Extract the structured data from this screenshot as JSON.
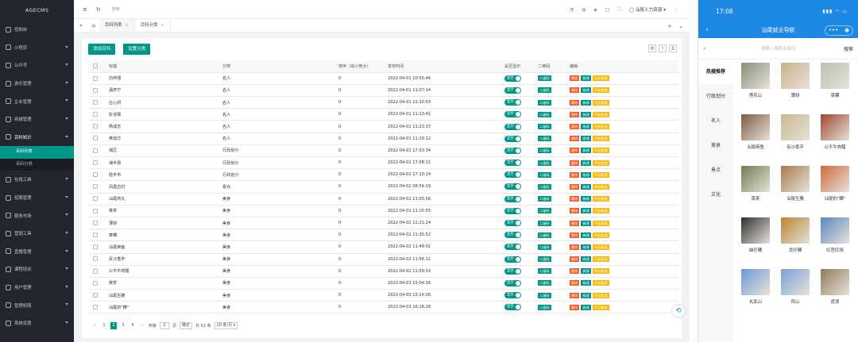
{
  "sidebar": {
    "logo": "AGECMS",
    "items": [
      {
        "label": "控制台",
        "icon": "dashboard-icon"
      },
      {
        "label": "小程序",
        "icon": "miniprogram-icon"
      },
      {
        "label": "公众号",
        "icon": "wechat-icon"
      },
      {
        "label": "游乐管理",
        "icon": "tour-icon"
      },
      {
        "label": "企业管理",
        "icon": "company-icon"
      },
      {
        "label": "商城管理",
        "icon": "shop-icon"
      },
      {
        "label": "百科知识",
        "icon": "knowledge-icon"
      },
      {
        "label": "在线工具",
        "icon": "tools-icon"
      },
      {
        "label": "招聘管理",
        "icon": "recruit-icon"
      },
      {
        "label": "服务市场",
        "icon": "market-icon"
      },
      {
        "label": "营销工具",
        "icon": "marketing-icon"
      },
      {
        "label": "直播管理",
        "icon": "live-icon"
      },
      {
        "label": "课程培训",
        "icon": "course-icon"
      },
      {
        "label": "用户管理",
        "icon": "user-icon"
      },
      {
        "label": "管理权限",
        "icon": "permission-icon"
      },
      {
        "label": "系统设置",
        "icon": "settings-icon"
      }
    ],
    "sub_items": [
      "百科列表",
      "百科分类"
    ]
  },
  "header": {
    "search_label": "搜索",
    "user": "汕尾人力资源"
  },
  "tabs": [
    "百科列表",
    "百科分类"
  ],
  "toolbar": {
    "add": "添加百科",
    "category": "设置分类"
  },
  "table": {
    "headers": [
      "标题",
      "分类",
      "排序（由小到大）",
      "发布时间",
      "是否显示",
      "二维码",
      "编辑"
    ],
    "show_label": "显示",
    "qr_label": "二维码",
    "del_label": "删除",
    "edit_label": "修改",
    "comment_label": "评论数据",
    "rows": [
      [
        "向仲强",
        "名人",
        "0",
        "2022-04-01 10:55:46"
      ],
      [
        "温彦宁",
        "名人",
        "0",
        "2022-04-01 11:07:14"
      ],
      [
        "庄心妍",
        "名人",
        "0",
        "2022-04-01 11:10:03"
      ],
      [
        "彭述振",
        "名人",
        "0",
        "2022-04-01 11:13:41"
      ],
      [
        "杨成志",
        "名人",
        "0",
        "2022-04-01 11:23:37"
      ],
      [
        "黄旭华",
        "名人",
        "0",
        "2022-04-01 11:29:12"
      ],
      [
        "城区",
        "行政划分",
        "0",
        "2022-04-01 17:03:34"
      ],
      [
        "海丰县",
        "行政划分",
        "0",
        "2022-04-01 17:08:11"
      ],
      [
        "陆丰市",
        "行政划分",
        "0",
        "2022-04-01 17:10:14"
      ],
      [
        "凤凰古村",
        "景点",
        "0",
        "2022-04-02 08:54:19"
      ],
      [
        "汕尾肉丸",
        "美食",
        "0",
        "2022-04-02 11:05:56"
      ],
      [
        "菜茶",
        "美食",
        "0",
        "2022-04-02 11:15:55"
      ],
      [
        "薄饼",
        "美食",
        "0",
        "2022-04-02 11:21:24"
      ],
      [
        "菜粿",
        "美食",
        "0",
        "2022-04-02 11:35:52"
      ],
      [
        "汕尾麻鱼",
        "美食",
        "0",
        "2022-04-02 11:49:01"
      ],
      [
        "反沙香芋",
        "美食",
        "0",
        "2022-04-02 11:56:11"
      ],
      [
        "公平牛肉醋",
        "美食",
        "0",
        "2022-04-02 11:59:14"
      ],
      [
        "菜茶",
        "美食",
        "0",
        "2022-04-03 15:04:16"
      ],
      [
        "汕尾生腌",
        "美食",
        "0",
        "2022-04-03 15:14:26"
      ],
      [
        "汕尾的\"粿\"",
        "美食",
        "0",
        "2022-04-03 16:18:28"
      ]
    ]
  },
  "pager": {
    "pages": [
      "1",
      "2",
      "3",
      "4"
    ],
    "current": "2",
    "goto_label": "到第",
    "goto_value": "2",
    "page_unit": "页",
    "confirm": "确定",
    "total": "共 62 条",
    "per_page": "20 条/页"
  },
  "phone": {
    "time": "17:08",
    "title": "汕尾就业导航",
    "search_placeholder": "请输入搜索关键词",
    "search_button": "搜索",
    "categories": [
      "热搜推荐",
      "行政划分",
      "名人",
      "美食",
      "景点",
      "文化"
    ],
    "grid": [
      {
        "name": "莲花山",
        "color": "#8a8f7a"
      },
      {
        "name": "薄饼",
        "color": "#c9b08a"
      },
      {
        "name": "菜粿",
        "color": "#b9c2b0"
      },
      {
        "name": "汕尾麻鱼",
        "color": "#7d5a44"
      },
      {
        "name": "反沙香芋",
        "color": "#c8b790"
      },
      {
        "name": "公平牛肉醋",
        "color": "#a0452f"
      },
      {
        "name": "菜茶",
        "color": "#6f7d52"
      },
      {
        "name": "汕尾生腌",
        "color": "#a87a4a"
      },
      {
        "name": "汕尾的\"粿\"",
        "color": "#d06a3c"
      },
      {
        "name": "曲仔粿",
        "color": "#2e2e2e"
      },
      {
        "name": "贡仔粿",
        "color": "#b9852f"
      },
      {
        "name": "红宫红场",
        "color": "#5d86c0"
      },
      {
        "name": "玄武山",
        "color": "#6c98d6"
      },
      {
        "name": "凤山",
        "color": "#7aa0d4"
      },
      {
        "name": "遮浪",
        "color": "#8f7a5a"
      }
    ]
  }
}
